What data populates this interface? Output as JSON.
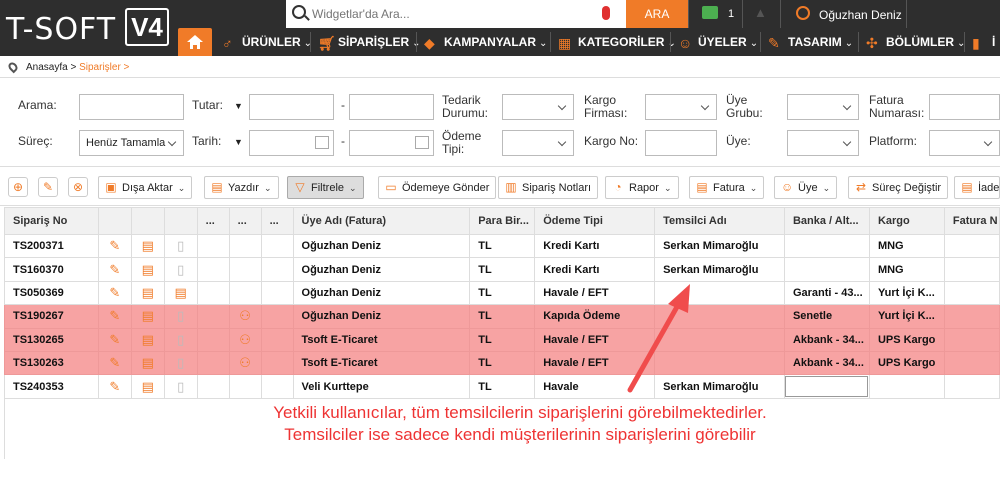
{
  "logo": {
    "text": "T-SOFT",
    "version": "V4"
  },
  "search": {
    "placeholder": "Widgetlar'da Ara...",
    "button": "ARA"
  },
  "top": {
    "messages": "1",
    "user": "Oğuzhan Deniz"
  },
  "nav": {
    "items": [
      "ÜRÜNLER",
      "SİPARİŞLER",
      "KAMPANYALAR",
      "KATEGORİLER",
      "ÜYELER",
      "TASARIM",
      "BÖLÜMLER",
      "İ"
    ]
  },
  "breadcrumb": {
    "home": "Anasayfa >",
    "current": "Siparişler >"
  },
  "filters": {
    "arama": "Arama:",
    "tutar": "Tutar:",
    "tedarik": "Tedarik Durumu:",
    "kargo_firmasi": "Kargo Firması:",
    "uye_grubu": "Üye Grubu:",
    "fatura_numarasi": "Fatura Numarası:",
    "surec": "Süreç:",
    "surec_value": "Henüz Tamamla",
    "tarih": "Tarih:",
    "odeme_tipi": "Ödeme Tipi:",
    "kargo_no": "Kargo No:",
    "uye": "Üye:",
    "platform": "Platform:",
    "dash": "-"
  },
  "toolbar": {
    "disa_aktar": "Dışa Aktar",
    "yazdir": "Yazdır",
    "filtrele": "Filtrele",
    "odemeye_gonder": "Ödemeye Gönder",
    "siparis_notlari": "Sipariş Notları",
    "rapor": "Rapor",
    "fatura": "Fatura",
    "uye": "Üye",
    "surec_degistir": "Süreç Değiştir",
    "iade": "İade"
  },
  "table": {
    "headers": [
      "Sipariş No",
      "",
      "",
      "",
      "...",
      "...",
      "...",
      "Üye Adı (Fatura)",
      "Para Bir...",
      "Ödeme Tipi",
      "Temsilci Adı",
      "Banka / Alt...",
      "Kargo",
      "Fatura N"
    ],
    "rows": [
      {
        "no": "TS200371",
        "uye": "Oğuzhan Deniz",
        "para": "TL",
        "odeme": "Kredi Kartı",
        "temsilci": "Serkan Mimaroğlu",
        "banka": "",
        "kargo": "MNG",
        "highlight": false
      },
      {
        "no": "TS160370",
        "uye": "Oğuzhan Deniz",
        "para": "TL",
        "odeme": "Kredi Kartı",
        "temsilci": "Serkan Mimaroğlu",
        "banka": "",
        "kargo": "MNG",
        "highlight": false
      },
      {
        "no": "TS050369",
        "uye": "Oğuzhan Deniz",
        "para": "TL",
        "odeme": "Havale / EFT",
        "temsilci": "",
        "banka": "Garanti - 43...",
        "kargo": "Yurt İçi K...",
        "highlight": false
      },
      {
        "no": "TS190267",
        "uye": "Oğuzhan Deniz",
        "para": "TL",
        "odeme": "Kapıda Ödeme",
        "temsilci": "",
        "banka": "Senetle",
        "kargo": "Yurt İçi K...",
        "highlight": true
      },
      {
        "no": "TS130265",
        "uye": "Tsoft E-Ticaret",
        "para": "TL",
        "odeme": "Havale / EFT",
        "temsilci": "",
        "banka": "Akbank - 34...",
        "kargo": "UPS Kargo",
        "highlight": true
      },
      {
        "no": "TS130263",
        "uye": "Tsoft E-Ticaret",
        "para": "TL",
        "odeme": "Havale / EFT",
        "temsilci": "",
        "banka": "Akbank - 34...",
        "kargo": "UPS Kargo",
        "highlight": true
      },
      {
        "no": "TS240353",
        "uye": "Veli Kurttepe",
        "para": "TL",
        "odeme": "Havale",
        "temsilci": "Serkan Mimaroğlu",
        "banka": "",
        "kargo": "",
        "highlight": false
      }
    ]
  },
  "note": {
    "line1": "Yetkili kullanıcılar, tüm temsilcilerin siparişlerini görebilmektedirler.",
    "line2": "Temsilciler ise sadece kendi müşterilerinin siparişlerini görebilir"
  },
  "colors": {
    "accent": "#f07b28",
    "highlight_row": "#f7a3a3",
    "note": "#e33333"
  }
}
